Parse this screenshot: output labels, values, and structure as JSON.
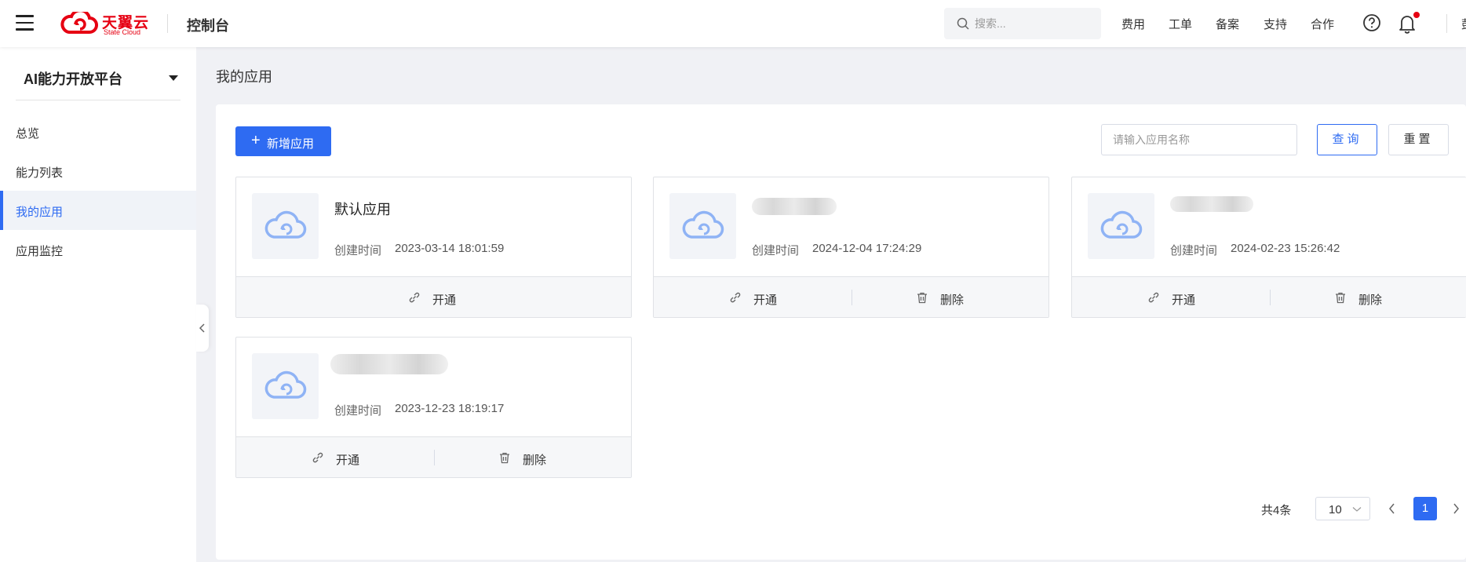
{
  "header": {
    "logo_cn": "天翼云",
    "logo_en": "State Cloud",
    "console_title": "控制台",
    "search_placeholder": "搜索...",
    "nav": [
      "费用",
      "工单",
      "备案",
      "支持",
      "合作"
    ],
    "user_fragment": "彭"
  },
  "sidebar": {
    "platform": "AI能力开放平台",
    "items": [
      "总览",
      "能力列表",
      "我的应用",
      "应用监控"
    ],
    "active_index": 2
  },
  "main": {
    "page_title": "我的应用",
    "add_button": "新增应用",
    "name_placeholder": "请输入应用名称",
    "query_button": "查询",
    "reset_button": "重置"
  },
  "cards": [
    {
      "name": "默认应用",
      "time_label": "创建时间",
      "time": "2023-03-14 18:01:59",
      "open_label": "开通"
    },
    {
      "name": "",
      "time_label": "创建时间",
      "time": "2024-12-04 17:24:29",
      "open_label": "开通",
      "delete_label": "删除"
    },
    {
      "name": "",
      "time_label": "创建时间",
      "time": "2024-02-23 15:26:42",
      "open_label": "开通",
      "delete_label": "删除"
    },
    {
      "name": "",
      "time_label": "创建时间",
      "time": "2023-12-23 18:19:17",
      "open_label": "开通",
      "delete_label": "删除"
    }
  ],
  "pagination": {
    "total_text": "共4条",
    "page_size": "10",
    "current_page": "1"
  },
  "colors": {
    "accent": "#2e6bf2",
    "brand": "#e60012"
  }
}
